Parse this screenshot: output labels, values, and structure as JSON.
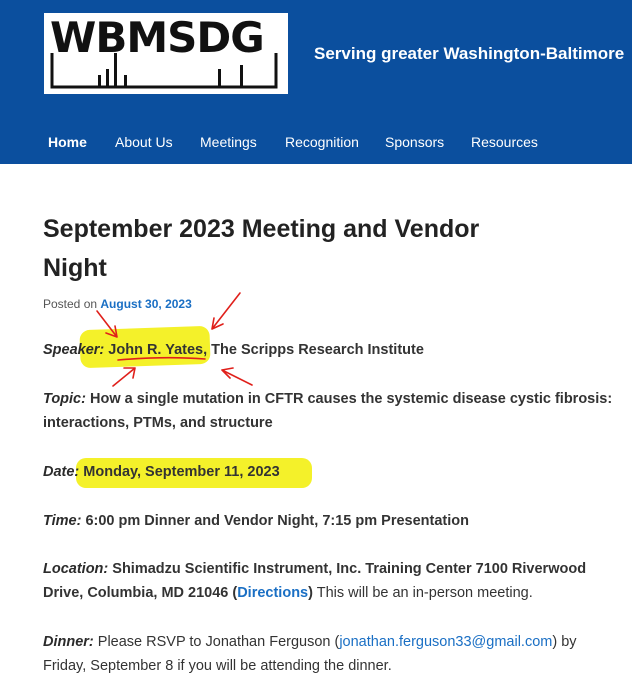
{
  "header": {
    "logo_text": "WBMSDG",
    "tagline": "Serving greater Washington-Baltimore"
  },
  "nav": {
    "items": [
      {
        "label": "Home",
        "active": true
      },
      {
        "label": "About Us"
      },
      {
        "label": "Meetings"
      },
      {
        "label": "Recognition"
      },
      {
        "label": "Sponsors"
      },
      {
        "label": "Resources"
      }
    ]
  },
  "post": {
    "title": "September 2023 Meeting and Vendor Night",
    "posted_prefix": "Posted on",
    "posted_date": "August 30, 2023",
    "speaker": {
      "label": "Speaker:",
      "name": "John R. Yates,",
      "affiliation": " The Scripps Research Institute"
    },
    "topic": {
      "label": "Topic:",
      "text": " How a single mutation in CFTR causes the systemic disease cystic fibrosis: interactions, PTMs, and structure"
    },
    "date": {
      "label": "Date:",
      "text": " Monday, September 11, 2023"
    },
    "time": {
      "label": "Time:",
      "text": " 6:00 pm Dinner and Vendor Night, 7:15 pm Presentation"
    },
    "location": {
      "label": "Location:",
      "text": " Shimadzu Scientific Instrument, Inc. Training Center 7100 Riverwood Drive, Columbia, MD 21046 (",
      "link": "Directions",
      "after": ")",
      "note": " This will be an in-person meeting."
    },
    "dinner": {
      "label": "Dinner:",
      "before": " Please RSVP to Jonathan Ferguson (",
      "email": "jonathan.ferguson33@gmail.com",
      "after": ") by Friday, September 8 if you will be attending the dinner."
    }
  },
  "colors": {
    "header_bg": "#0b4f9e",
    "highlight": "#f4f12a",
    "annotation": "#e0201b",
    "link": "#1a6fc4"
  }
}
